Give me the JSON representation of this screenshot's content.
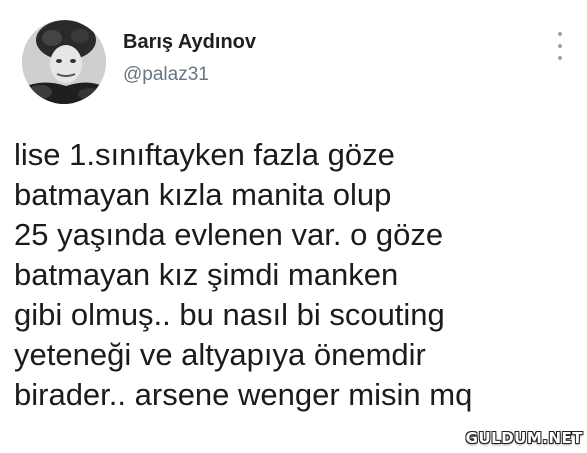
{
  "tweet": {
    "display_name": "Barış Aydınov",
    "handle": "@palaz31",
    "more_icon": "more-vertical-icon",
    "text_lines": [
      "lise 1.sınıftayken fazla göze",
      "batmayan kızla manita olup",
      "25 yaşında evlenen var. o göze",
      "batmayan kız şimdi manken",
      "gibi olmuş.. bu nasıl bi scouting",
      "yeteneği ve altyapıya önemdir",
      "birader.. arsene wenger misin mq"
    ]
  },
  "watermark": "GULDUM.NET",
  "colors": {
    "background": "#ffffff",
    "name": "#1c1e21",
    "handle": "#687684",
    "text": "#1b1b1b",
    "dots": "#9aa3ac"
  }
}
